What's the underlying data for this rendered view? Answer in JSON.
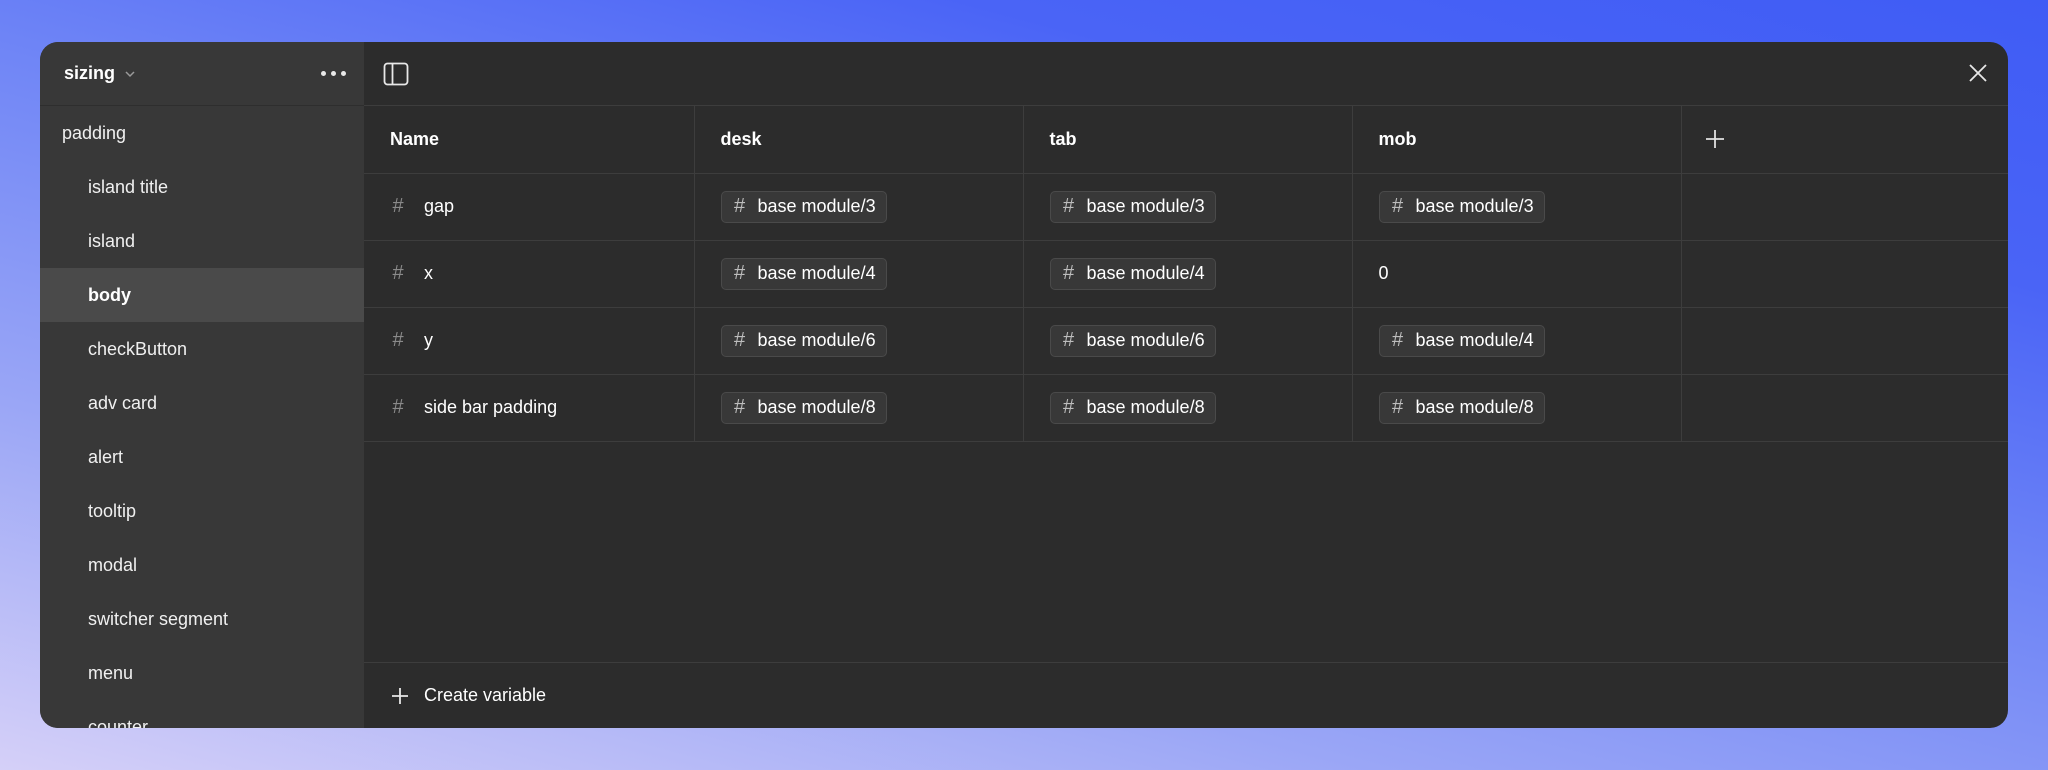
{
  "sidebar": {
    "collection_title": "sizing",
    "groups": [
      {
        "label": "padding",
        "root": true
      },
      {
        "label": "island title"
      },
      {
        "label": "island"
      },
      {
        "label": "body",
        "selected": true
      },
      {
        "label": "checkButton"
      },
      {
        "label": "adv card"
      },
      {
        "label": "alert"
      },
      {
        "label": "tooltip"
      },
      {
        "label": "modal"
      },
      {
        "label": "switcher segment"
      },
      {
        "label": "menu"
      },
      {
        "label": "counter"
      }
    ]
  },
  "table": {
    "columns": [
      "Name",
      "desk",
      "tab",
      "mob"
    ],
    "rows": [
      {
        "name": "gap",
        "values": [
          {
            "alias": "base module/3"
          },
          {
            "alias": "base module/3"
          },
          {
            "alias": "base module/3"
          }
        ]
      },
      {
        "name": "x",
        "values": [
          {
            "alias": "base module/4"
          },
          {
            "alias": "base module/4"
          },
          {
            "text": "0"
          }
        ]
      },
      {
        "name": "y",
        "values": [
          {
            "alias": "base module/6"
          },
          {
            "alias": "base module/6"
          },
          {
            "alias": "base module/4"
          }
        ]
      },
      {
        "name": "side bar padding",
        "values": [
          {
            "alias": "base module/8"
          },
          {
            "alias": "base module/8"
          },
          {
            "alias": "base module/8"
          }
        ]
      }
    ]
  },
  "footer": {
    "create_label": "Create variable"
  },
  "colors": {
    "window_bg": "#2c2c2c",
    "sidebar_bg": "#383838",
    "selected_bg": "#4a4a4a",
    "gradient_start": "#d5d0f8",
    "gradient_end": "#3f5cf5"
  },
  "icons": [
    "chevron-down-icon",
    "more-icon",
    "sidebar-panel-icon",
    "close-icon",
    "hash-icon",
    "plus-icon"
  ]
}
